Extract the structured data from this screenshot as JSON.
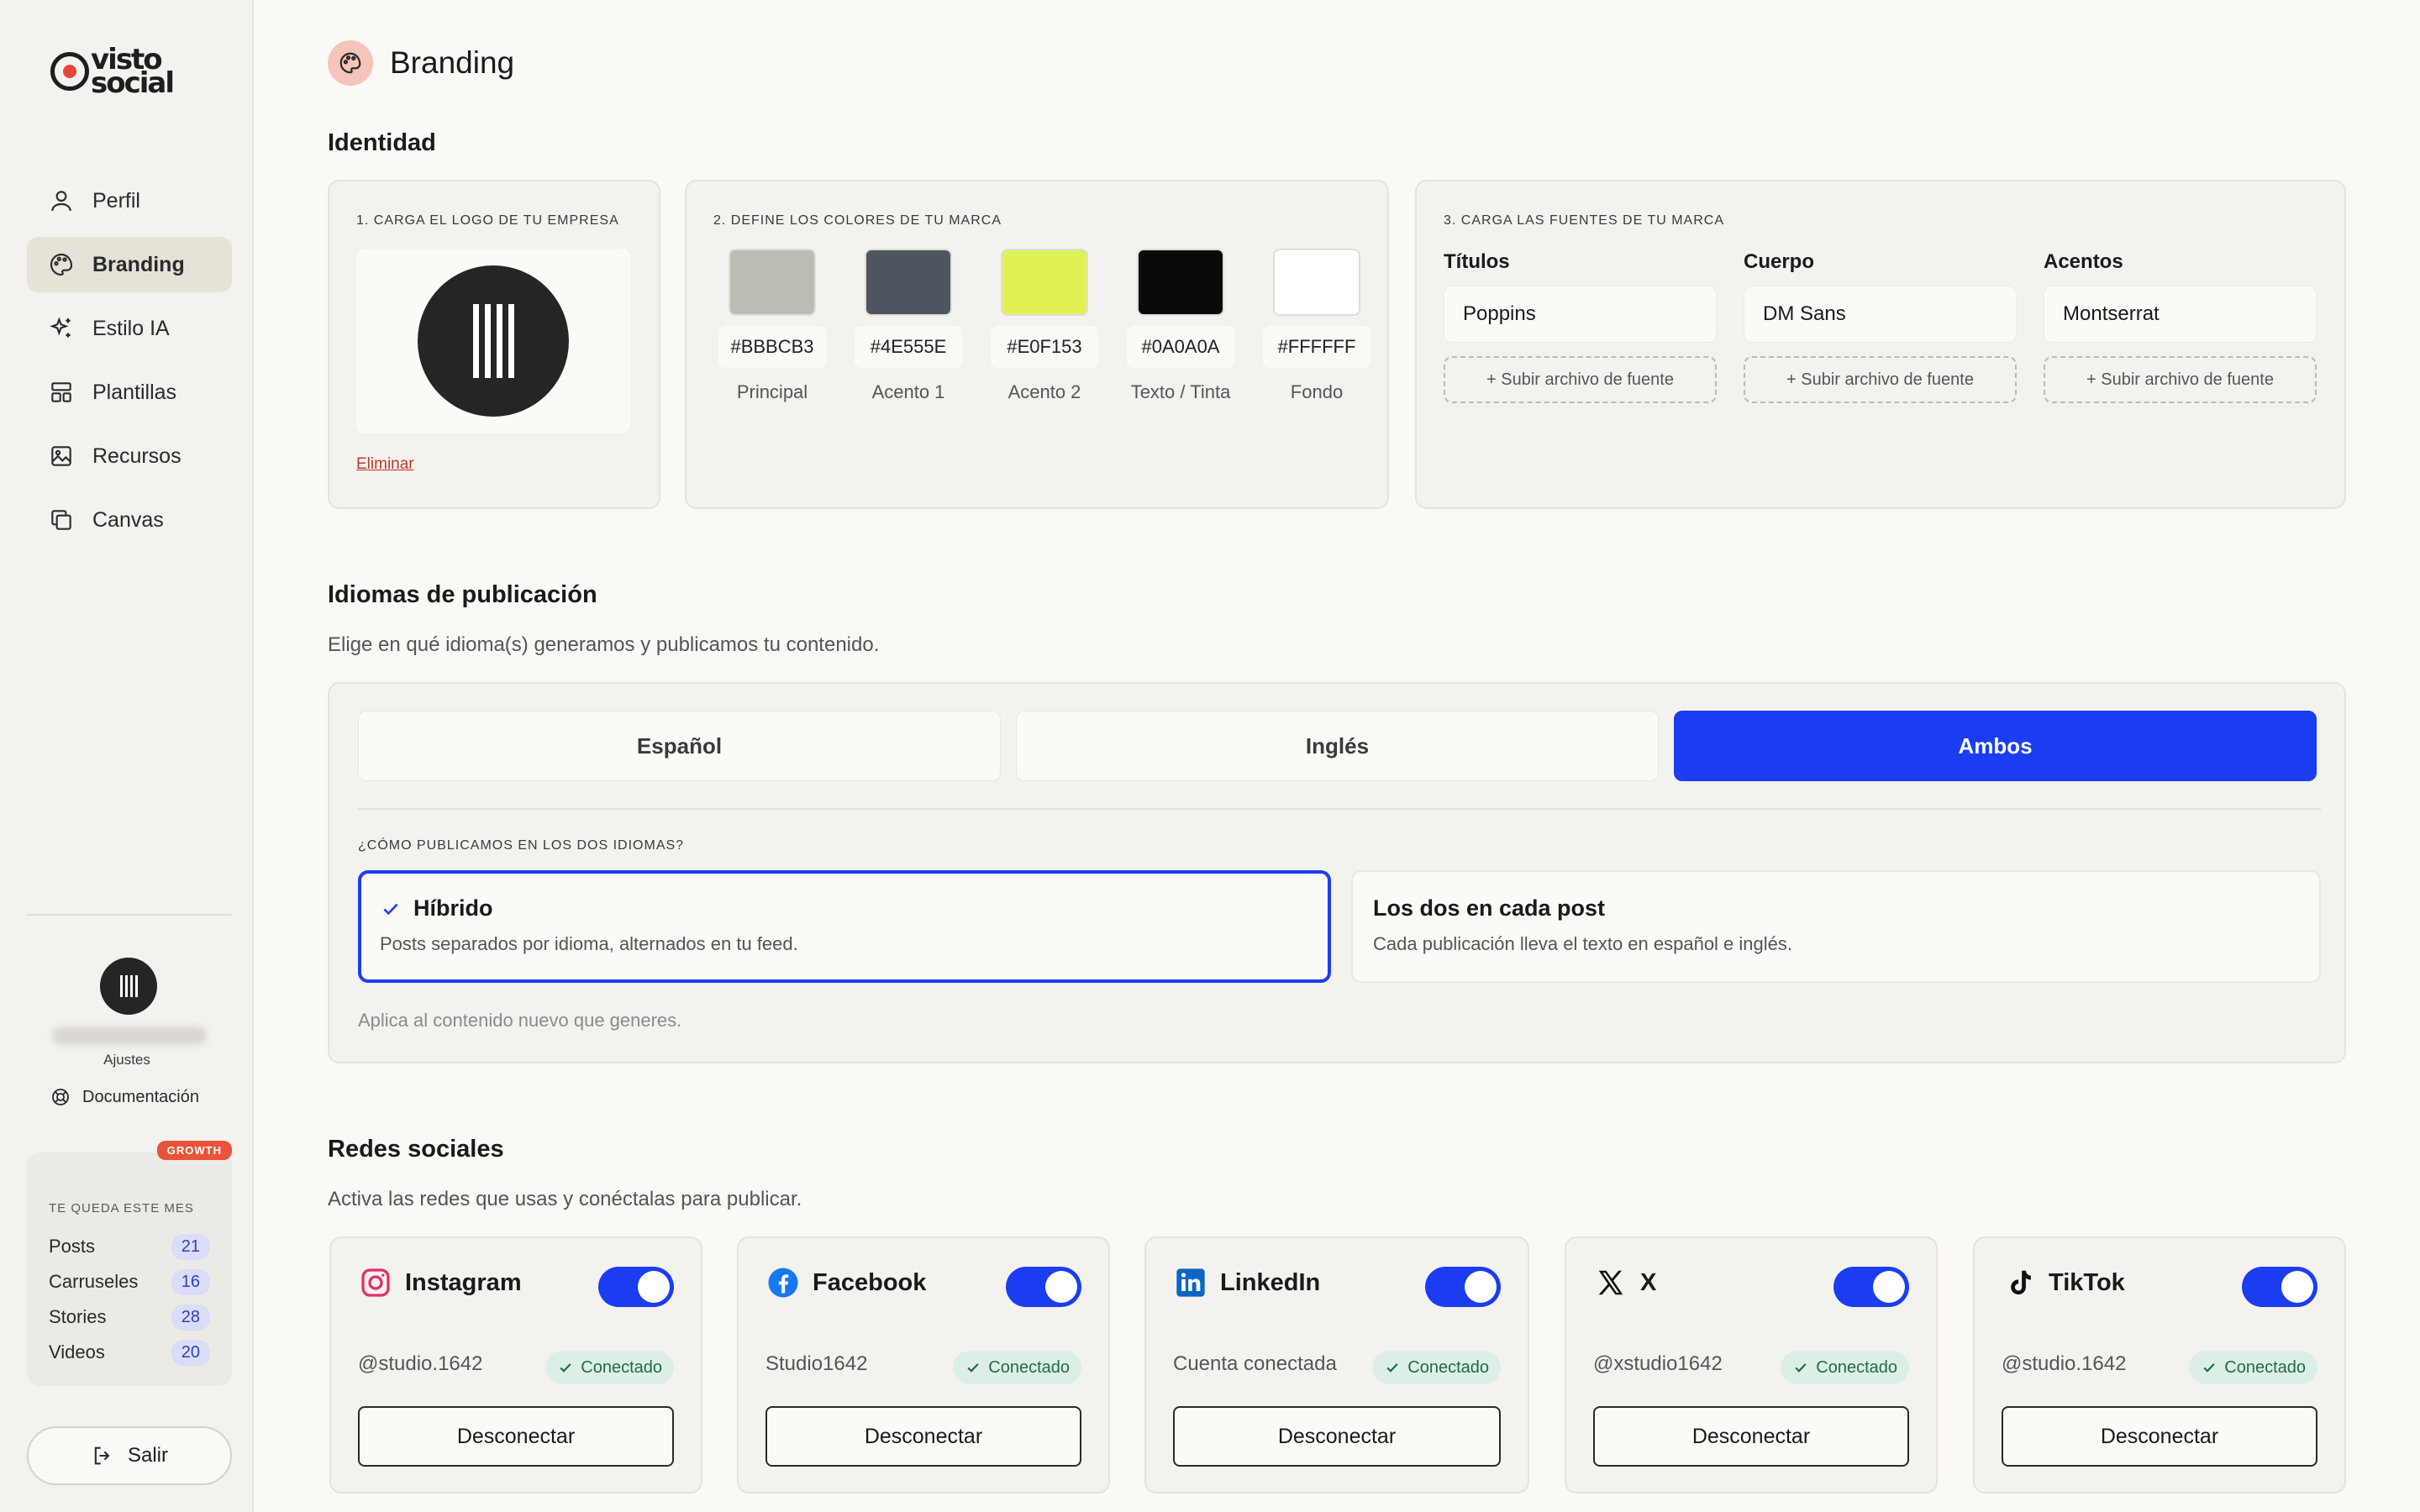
{
  "app": {
    "logo_line1": "visto",
    "logo_line2": "social"
  },
  "sidebar": {
    "items": [
      {
        "label": "Perfil",
        "icon": "user-icon",
        "active": false
      },
      {
        "label": "Branding",
        "icon": "palette-icon",
        "active": true
      },
      {
        "label": "Estilo IA",
        "icon": "sparkles-icon",
        "active": false
      },
      {
        "label": "Plantillas",
        "icon": "layout-icon",
        "active": false
      },
      {
        "label": "Recursos",
        "icon": "image-icon",
        "active": false
      },
      {
        "label": "Canvas",
        "icon": "copy-icon",
        "active": false
      }
    ],
    "settings_label": "Ajustes",
    "docs_label": "Documentación",
    "usage": {
      "badge": "GROWTH",
      "title": "TE QUEDA ESTE MES",
      "rows": [
        {
          "label": "Posts",
          "count": "21"
        },
        {
          "label": "Carruseles",
          "count": "16"
        },
        {
          "label": "Stories",
          "count": "28"
        },
        {
          "label": "Videos",
          "count": "20"
        }
      ]
    },
    "logout_label": "Salir"
  },
  "header": {
    "title": "Branding",
    "icon": "palette-icon"
  },
  "identity": {
    "title": "Identidad",
    "logo": {
      "label": "1. CARGA EL LOGO DE TU EMPRESA",
      "delete_label": "Eliminar"
    },
    "colors": {
      "label": "2. DEFINE LOS COLORES DE TU MARCA",
      "items": [
        {
          "hex": "#BBBCB3",
          "name": "Principal"
        },
        {
          "hex": "#4E555E",
          "name": "Acento 1"
        },
        {
          "hex": "#E0F153",
          "name": "Acento 2"
        },
        {
          "hex": "#0A0A0A",
          "name": "Texto / Tinta"
        },
        {
          "hex": "#FFFFFF",
          "name": "Fondo"
        }
      ]
    },
    "fonts": {
      "label": "3. CARGA LAS FUENTES DE TU MARCA",
      "items": [
        {
          "heading": "Títulos",
          "value": "Poppins",
          "upload": "+ Subir archivo de fuente"
        },
        {
          "heading": "Cuerpo",
          "value": "DM Sans",
          "upload": "+ Subir archivo de fuente"
        },
        {
          "heading": "Acentos",
          "value": "Montserrat",
          "upload": "+ Subir archivo de fuente"
        }
      ]
    }
  },
  "languages": {
    "title": "Idiomas de publicación",
    "subtitle": "Elige en qué idioma(s) generamos y publicamos tu contenido.",
    "tabs": [
      {
        "label": "Español",
        "active": false
      },
      {
        "label": "Inglés",
        "active": false
      },
      {
        "label": "Ambos",
        "active": true
      }
    ],
    "question": "¿CÓMO PUBLICAMOS EN LOS DOS IDIOMAS?",
    "options": [
      {
        "title": "Híbrido",
        "desc": "Posts separados por idioma, alternados en tu feed.",
        "selected": true
      },
      {
        "title": "Los dos en cada post",
        "desc": "Cada publicación lleva el texto en español e inglés.",
        "selected": false
      }
    ],
    "note": "Aplica al contenido nuevo que generes."
  },
  "social": {
    "title": "Redes sociales",
    "subtitle": "Activa las redes que usas y conéctalas para publicar.",
    "networks": [
      {
        "name": "Instagram",
        "icon": "instagram-icon",
        "handle": "@studio.1642",
        "status": "Conectado",
        "button": "Desconectar",
        "enabled": true
      },
      {
        "name": "Facebook",
        "icon": "facebook-icon",
        "handle": "Studio1642",
        "status": "Conectado",
        "button": "Desconectar",
        "enabled": true
      },
      {
        "name": "LinkedIn",
        "icon": "linkedin-icon",
        "handle": "Cuenta conectada",
        "status": "Conectado",
        "button": "Desconectar",
        "enabled": true
      },
      {
        "name": "X",
        "icon": "x-icon",
        "handle": "@xstudio1642",
        "status": "Conectado",
        "button": "Desconectar",
        "enabled": true
      },
      {
        "name": "TikTok",
        "icon": "tiktok-icon",
        "handle": "@studio.1642",
        "status": "Conectado",
        "button": "Desconectar",
        "enabled": true
      }
    ]
  },
  "colors": {
    "accent": "#1B3DF2",
    "connected": "#1F6B47",
    "danger": "#C0392B"
  }
}
